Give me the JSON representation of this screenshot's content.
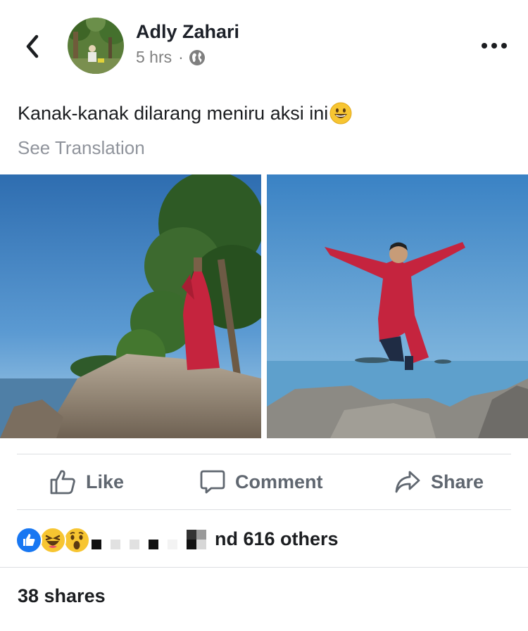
{
  "post": {
    "author": "Adly Zahari",
    "time": "5 hrs",
    "separator": "·",
    "privacy_icon": "globe-icon",
    "caption": "Kanak-kanak dilarang meniru aksi ini",
    "caption_emoji": "smiling-face-emoji",
    "see_translation": "See Translation"
  },
  "actions": {
    "like": "Like",
    "comment": "Comment",
    "share": "Share"
  },
  "reactions": {
    "types": [
      "like",
      "haha",
      "wow"
    ],
    "others_text": "nd 616 others"
  },
  "shares_text": "38 shares",
  "colors": {
    "like_blue": "#1877f2",
    "emoji_yellow": "#f7c531",
    "robe_red": "#c5243e",
    "sky_blue": "#4f93c7"
  }
}
